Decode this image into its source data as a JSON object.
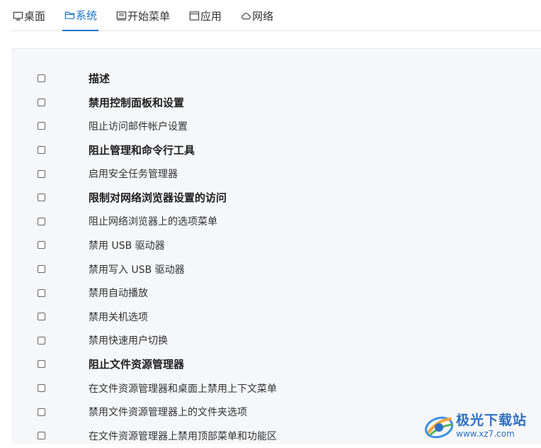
{
  "tabs": [
    {
      "label": "桌面",
      "icon": "monitor-icon",
      "active": false
    },
    {
      "label": "系统",
      "icon": "folder-icon",
      "active": true
    },
    {
      "label": "开始菜单",
      "icon": "start-menu-icon",
      "active": false
    },
    {
      "label": "应用",
      "icon": "window-icon",
      "active": false
    },
    {
      "label": "网络",
      "icon": "cloud-icon",
      "active": false
    }
  ],
  "options": [
    {
      "label": "描述",
      "bold": true
    },
    {
      "label": "禁用控制面板和设置",
      "bold": true
    },
    {
      "label": "阻止访问邮件帐户设置",
      "bold": false
    },
    {
      "label": "阻止管理和命令行工具",
      "bold": true
    },
    {
      "label": "启用安全任务管理器",
      "bold": false
    },
    {
      "label": "限制对网络浏览器设置的访问",
      "bold": true
    },
    {
      "label": "阻止网络浏览器上的选项菜单",
      "bold": false
    },
    {
      "label": "禁用 USB 驱动器",
      "bold": false
    },
    {
      "label": "禁用写入 USB 驱动器",
      "bold": false
    },
    {
      "label": "禁用自动播放",
      "bold": false
    },
    {
      "label": "禁用关机选项",
      "bold": false
    },
    {
      "label": "禁用快速用户切换",
      "bold": false
    },
    {
      "label": "阻止文件资源管理器",
      "bold": true
    },
    {
      "label": "在文件资源管理器和桌面上禁用上下文菜单",
      "bold": false
    },
    {
      "label": "禁用文件资源管理器上的文件夹选项",
      "bold": false
    },
    {
      "label": "在文件资源管理器上禁用顶部菜单和功能区",
      "bold": false
    }
  ],
  "watermark": {
    "name": "极光下载站",
    "url": "www.xz7.com"
  },
  "colors": {
    "accent": "#1a73c9",
    "panel_bg": "#f5f7fa"
  }
}
